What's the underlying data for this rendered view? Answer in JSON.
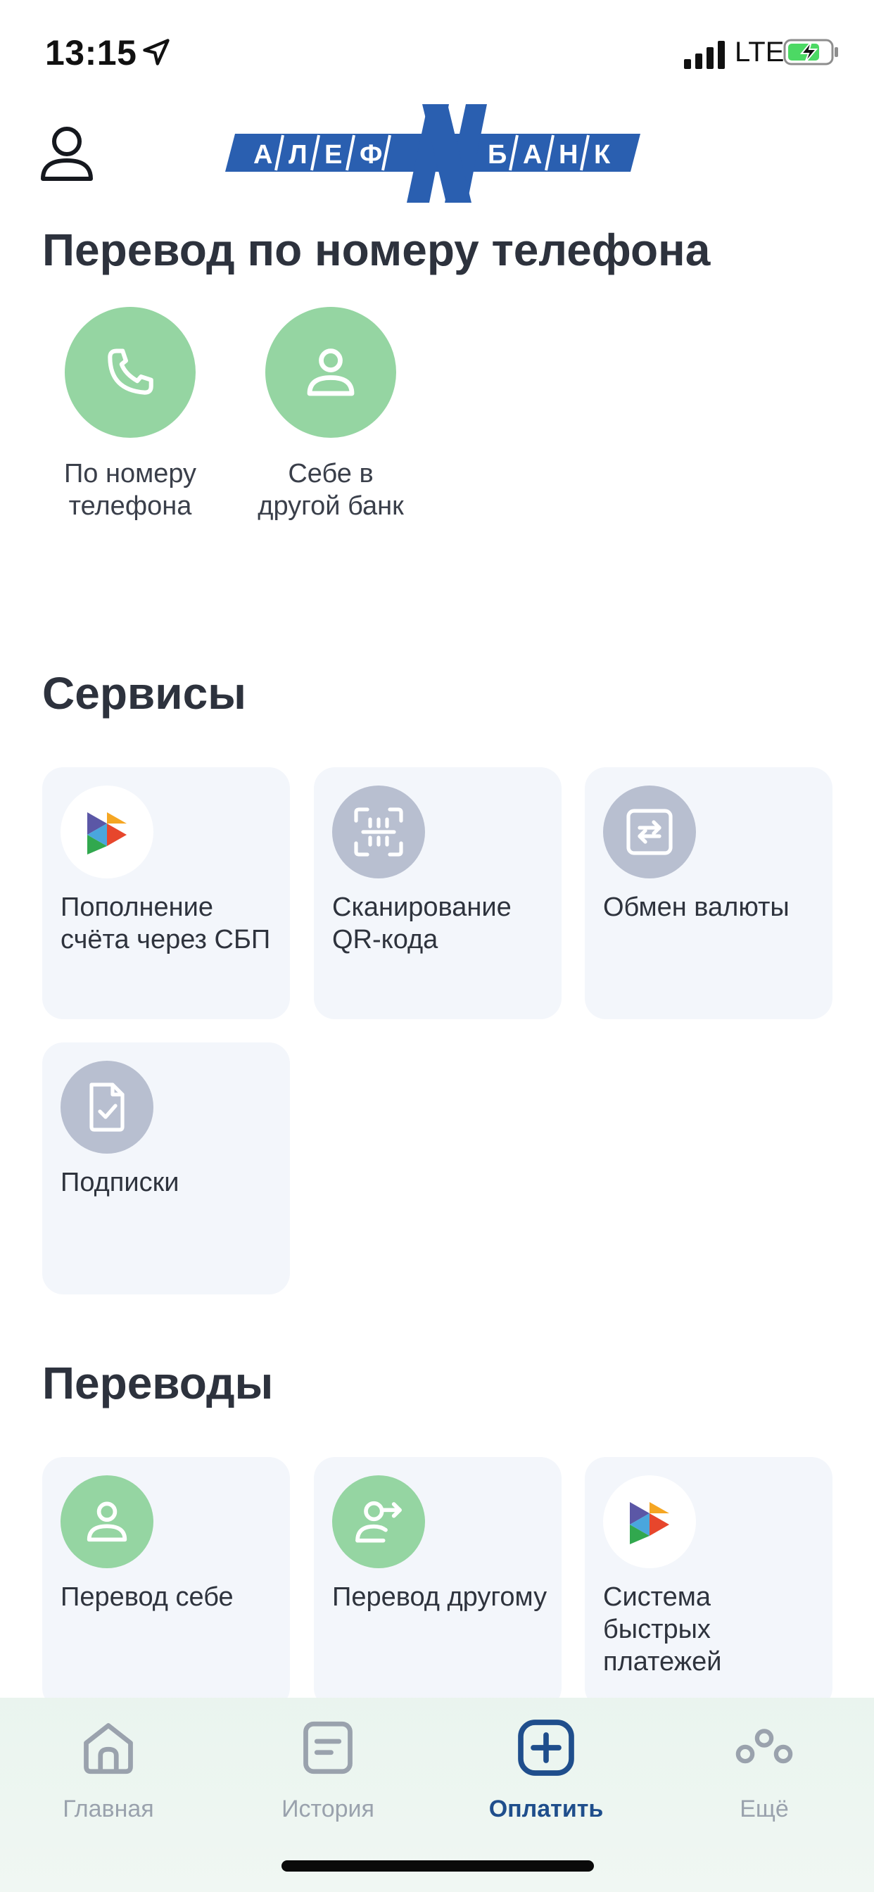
{
  "status_bar": {
    "time": "13:15",
    "network": "LTE"
  },
  "header": {
    "logo_text": "АЛЕФ БАНК",
    "logo_letters": [
      "А",
      "Л",
      "Е",
      "Ф",
      "Б",
      "А",
      "Н",
      "К"
    ],
    "logo_emblem": "N"
  },
  "phone_transfer": {
    "title": "Перевод по номеру телефона",
    "items": [
      {
        "label": "По номеру\nтелефона",
        "icon": "phone-icon"
      },
      {
        "label": "Себе в\nдругой банк",
        "icon": "person-icon"
      }
    ]
  },
  "services": {
    "title": "Сервисы",
    "items": [
      {
        "label": "Пополнение счёта через СБП",
        "icon": "sbp-icon"
      },
      {
        "label": "Сканирование QR-кода",
        "icon": "qr-scan-icon"
      },
      {
        "label": "Обмен валюты",
        "icon": "currency-exchange-icon"
      },
      {
        "label": "Подписки",
        "icon": "document-check-icon"
      }
    ]
  },
  "transfers": {
    "title": "Переводы",
    "items": [
      {
        "label": "Перевод себе",
        "icon": "person-icon"
      },
      {
        "label": "Перевод другому",
        "icon": "person-arrow-icon"
      },
      {
        "label": "Система быстрых платежей",
        "icon": "sbp-icon"
      }
    ]
  },
  "tab_bar": {
    "tabs": [
      {
        "label": "Главная",
        "icon": "home-icon"
      },
      {
        "label": "История",
        "icon": "history-icon"
      },
      {
        "label": "Оплатить",
        "icon": "plus-square-icon",
        "active": true
      },
      {
        "label": "Ещё",
        "icon": "more-icon"
      }
    ]
  },
  "colors": {
    "accent_green": "#95d5a2",
    "icon_grey": "#b8bfd0",
    "card_bg": "#f3f6fb",
    "active_tab": "#1f4e8c",
    "inactive_tab": "#9aa2ad",
    "logo_blue": "#2a5fb0"
  }
}
